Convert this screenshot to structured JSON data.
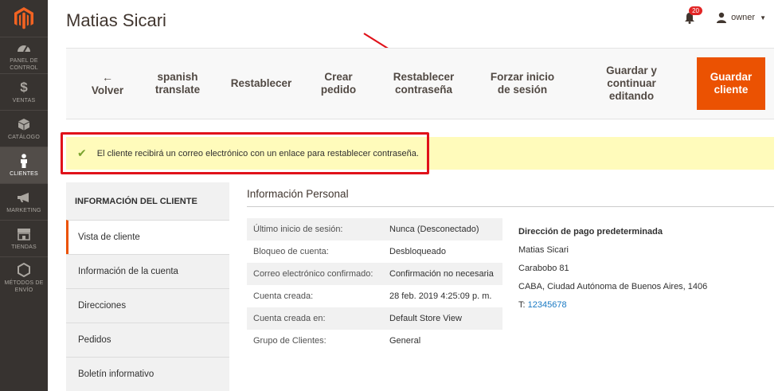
{
  "sidebar": {
    "items": [
      {
        "label": "PANEL DE CONTROL",
        "icon": "dashboard-icon"
      },
      {
        "label": "VENTAS",
        "icon": "dollar-icon"
      },
      {
        "label": "CATÁLOGO",
        "icon": "box-icon"
      },
      {
        "label": "CLIENTES",
        "icon": "person-icon",
        "active": true
      },
      {
        "label": "MARKETING",
        "icon": "megaphone-icon"
      },
      {
        "label": "TIENDAS",
        "icon": "store-icon"
      },
      {
        "label": "MÉTODOS DE ENVÍO",
        "icon": "hexagon-icon"
      }
    ]
  },
  "header": {
    "title": "Matias Sicari",
    "notifications": "20",
    "user": "owner"
  },
  "toolbar": {
    "back": "Volver",
    "spanish_translate": "spanish translate",
    "reset": "Restablecer",
    "create_order": "Crear pedido",
    "reset_password": "Restablecer contraseña",
    "force_login": "Forzar inicio de sesión",
    "save_continue": "Guardar y continuar editando",
    "save": "Guardar cliente"
  },
  "message": "El cliente recibirá un correo electrónico con un enlace para restablecer contraseña.",
  "tabs": {
    "title": "INFORMACIÓN DEL CLIENTE",
    "items": [
      "Vista de cliente",
      "Información de la cuenta",
      "Direcciones",
      "Pedidos",
      "Boletín informativo"
    ]
  },
  "personal": {
    "title": "Información Personal",
    "rows": [
      {
        "label": "Último inicio de sesión:",
        "value": "Nunca (Desconectado)"
      },
      {
        "label": "Bloqueo de cuenta:",
        "value": "Desbloqueado"
      },
      {
        "label": "Correo electrónico confirmado:",
        "value": "Confirmación no necesaria"
      },
      {
        "label": "Cuenta creada:",
        "value": "28 feb. 2019 4:25:09 p. m."
      },
      {
        "label": "Cuenta creada en:",
        "value": "Default Store View"
      },
      {
        "label": "Grupo de Clientes:",
        "value": "General"
      }
    ]
  },
  "address": {
    "title": "Dirección de pago predeterminada",
    "name": "Matias Sicari",
    "street": "Carabobo 81",
    "city": "CABA, Ciudad Autónoma de Buenos Aires, 1406",
    "tel_prefix": "T:",
    "tel": "12345678"
  },
  "colors": {
    "sidebar": "#373330",
    "accent": "#eb5202",
    "message_bg": "#fffbbb",
    "annotation": "#e0121a",
    "link": "#1979c3"
  }
}
